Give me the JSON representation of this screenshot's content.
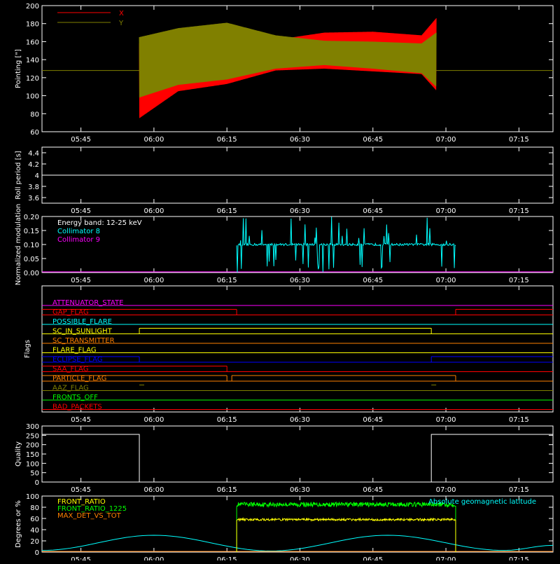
{
  "time_axis": {
    "ticks": [
      "05:45",
      "06:00",
      "06:15",
      "06:30",
      "06:45",
      "07:00",
      "07:15"
    ],
    "start": "05:37",
    "end": "07:22"
  },
  "chart_data": [
    {
      "id": "pointing",
      "type": "line",
      "ylabel": "Pointing [\"]",
      "ylim": [
        60,
        200
      ],
      "yticks": [
        60,
        80,
        100,
        120,
        140,
        160,
        180,
        200
      ],
      "legend": {
        "placement": "top-left",
        "entries": [
          {
            "name": "X",
            "color": "#ff0000"
          },
          {
            "name": "Y",
            "color": "#808000"
          }
        ]
      },
      "series": [
        {
          "name": "X",
          "color": "#ff0000",
          "envelope": [
            {
              "t": "05:57",
              "low": 75,
              "high": 158
            },
            {
              "t": "06:05",
              "low": 105,
              "high": 167
            },
            {
              "t": "06:15",
              "low": 113,
              "high": 168
            },
            {
              "t": "06:25",
              "low": 128,
              "high": 162
            },
            {
              "t": "06:35",
              "low": 130,
              "high": 170
            },
            {
              "t": "06:45",
              "low": 127,
              "high": 171
            },
            {
              "t": "06:55",
              "low": 124,
              "high": 167
            },
            {
              "t": "06:58",
              "low": 106,
              "high": 186
            }
          ]
        },
        {
          "name": "Y",
          "color": "#808000",
          "baseline": 128,
          "envelope": [
            {
              "t": "05:57",
              "low": 98,
              "high": 165
            },
            {
              "t": "06:05",
              "low": 112,
              "high": 175
            },
            {
              "t": "06:15",
              "low": 118,
              "high": 181
            },
            {
              "t": "06:25",
              "low": 130,
              "high": 167
            },
            {
              "t": "06:35",
              "low": 134,
              "high": 161
            },
            {
              "t": "06:45",
              "low": 130,
              "high": 160
            },
            {
              "t": "06:55",
              "low": 125,
              "high": 158
            },
            {
              "t": "06:58",
              "low": 110,
              "high": 170
            }
          ]
        }
      ]
    },
    {
      "id": "roll",
      "type": "line",
      "ylabel": "Roll period [s]",
      "ylim": [
        3.5,
        4.5
      ],
      "yticks": [
        3.6,
        3.8,
        4.0,
        4.2,
        4.4
      ],
      "series": [
        {
          "name": "",
          "color": "#ffffff",
          "value": 4.0,
          "t_start": "05:37",
          "t_end": "07:22"
        }
      ]
    },
    {
      "id": "modulation",
      "type": "bar",
      "ylabel": "Normalized modulation",
      "ylim": [
        0,
        0.2
      ],
      "yticks": [
        "0.00",
        "0.05",
        "0.10",
        "0.15",
        "0.20"
      ],
      "annotation": "Energy band: 12-25 keV",
      "legend": {
        "placement": "top-left",
        "entries": [
          {
            "name": "Collimator 8",
            "color": "#00ffff"
          },
          {
            "name": "Collimator 9",
            "color": "#ff00ff"
          }
        ]
      },
      "series": [
        {
          "name": "Collimator 8",
          "color": "#00ffff",
          "t_start": "06:17",
          "t_end": "07:02",
          "typical": 0.1,
          "min": 0.0,
          "max": 0.2
        },
        {
          "name": "Collimator 9",
          "color": "#ff00ff",
          "value": 0.0
        }
      ]
    },
    {
      "id": "flags",
      "type": "line",
      "ylabel": "Flags",
      "flags": [
        {
          "name": "ATTENUATOR_STATE",
          "color": "#ff00ff",
          "segments": []
        },
        {
          "name": "GAP_FLAG",
          "color": "#ff0000",
          "segments": [
            [
              "05:37",
              "06:17",
              1
            ],
            [
              "06:17",
              "07:02",
              0
            ],
            [
              "07:02",
              "07:22",
              1
            ]
          ]
        },
        {
          "name": "POSSIBLE_FLARE",
          "color": "#00ffff",
          "segments": []
        },
        {
          "name": "SC_IN_SUNLIGHT",
          "color": "#ffff00",
          "segments": [
            [
              "05:37",
              "05:57",
              0
            ],
            [
              "05:57",
              "06:57",
              1
            ],
            [
              "06:57",
              "07:22",
              0
            ]
          ]
        },
        {
          "name": "SC_TRANSMITTER",
          "color": "#ff8000",
          "segments": []
        },
        {
          "name": "FLARE_FLAG",
          "color": "#ffff00",
          "segments": []
        },
        {
          "name": "ECLIPSE_FLAG",
          "color": "#0000ff",
          "segments": [
            [
              "05:37",
              "05:57",
              1
            ],
            [
              "05:57",
              "06:57",
              0
            ],
            [
              "06:57",
              "07:22",
              1
            ]
          ]
        },
        {
          "name": "SAA_FLAG",
          "color": "#ff0000",
          "segments": [
            [
              "05:37",
              "06:15",
              1
            ],
            [
              "06:15",
              "07:22",
              0
            ]
          ]
        },
        {
          "name": "PARTICLE_FLAG",
          "color": "#ff8000",
          "segments": [
            [
              "05:37",
              "06:15",
              1
            ],
            [
              "06:15",
              "06:16",
              0
            ],
            [
              "06:16",
              "06:17",
              1
            ],
            [
              "06:17",
              "07:02",
              1
            ],
            [
              "07:02",
              "07:22",
              0
            ]
          ]
        },
        {
          "name": "AAZ_FLAG",
          "color": "#808000",
          "segments": [
            [
              "05:57",
              "05:58",
              1
            ],
            [
              "06:57",
              "06:58",
              1
            ]
          ]
        },
        {
          "name": "FRONTS_OFF",
          "color": "#00ff00",
          "segments": []
        },
        {
          "name": "BAD_PACKETS",
          "color": "#ff0000",
          "segments": []
        }
      ]
    },
    {
      "id": "quality",
      "type": "line",
      "ylabel": "Quality",
      "ylim": [
        0,
        300
      ],
      "yticks": [
        0,
        50,
        100,
        150,
        200,
        250,
        300
      ],
      "series": [
        {
          "name": "",
          "color": "#ffffff",
          "points": [
            [
              "05:37",
              255
            ],
            [
              "05:57",
              255
            ],
            [
              "05:57",
              0
            ],
            [
              "06:57",
              0
            ],
            [
              "06:57",
              255
            ],
            [
              "07:22",
              255
            ]
          ]
        }
      ]
    },
    {
      "id": "ratios",
      "type": "line",
      "ylabel": "Degrees or %",
      "ylim": [
        0,
        100
      ],
      "yticks": [
        0,
        20,
        40,
        60,
        80,
        100
      ],
      "legend": {
        "placement": "top-left",
        "entries": [
          {
            "name": "FRONT_RATIO",
            "color": "#ffff00"
          },
          {
            "name": "FRONT_RATIO_1225",
            "color": "#00ff00"
          },
          {
            "name": "MAX_DET_VS_TOT",
            "color": "#ff8000"
          }
        ]
      },
      "annotation": "Absolute geomagnetic latitude",
      "annotation_color": "#00ffff",
      "series": [
        {
          "name": "FRONT_RATIO",
          "color": "#ffff00",
          "t_start": "06:17",
          "t_end": "07:02",
          "typical": 58
        },
        {
          "name": "FRONT_RATIO_1225",
          "color": "#00ff00",
          "t_start": "06:17",
          "t_end": "07:02",
          "typical": 85
        },
        {
          "name": "MAX_DET_VS_TOT",
          "color": "#ff8000",
          "value": 0
        },
        {
          "name": "Absolute geomagnetic latitude",
          "color": "#00ffff",
          "points": [
            [
              "05:37",
              3
            ],
            [
              "06:00",
              30
            ],
            [
              "06:24",
              2
            ],
            [
              "06:48",
              30
            ],
            [
              "07:12",
              3
            ],
            [
              "07:22",
              12
            ]
          ]
        }
      ]
    }
  ]
}
